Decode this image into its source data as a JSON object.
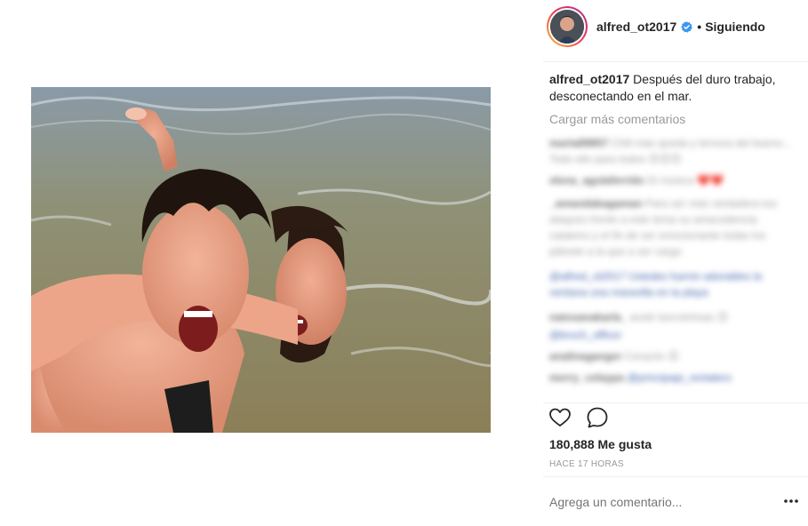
{
  "header": {
    "username": "alfred_ot2017",
    "dot": "•",
    "follow_status": "Siguiendo"
  },
  "caption": {
    "username": "alfred_ot2017",
    "text": "Después del duro trabajo, desconectando en el mar."
  },
  "load_more_label": "Cargar más comentarios",
  "likes": "180,888 Me gusta",
  "timestamp": "HACE 17 HORAS",
  "comment_input": {
    "placeholder": "Agrega un comentario..."
  },
  "blurred_comments": [
    {
      "user": "marta89857",
      "text": "Chill más queda y ternura del bueno... Todo ello para todos 😊😊😊"
    },
    {
      "user": "elena_agulaferrido",
      "text": "Di música ❤️❤️"
    },
    {
      "user": "_amandabagaman",
      "text": "Para ser más verdadera tus ataques frente a este tema su amacedencia cataleno y el fin de ser emocionante todas los plánete a la que a ser cargo"
    },
    {
      "user": "",
      "text": "@alfred_ot2017 Ustedes fuerón adorables la ventana una maravilla en la playa"
    },
    {
      "user": "natosanakarla_",
      "text": "acelir borrolchoas 😊"
    },
    {
      "user": "",
      "text": "@bruch_officer"
    },
    {
      "user": "analinaganger",
      "text": "Corazón 😊"
    },
    {
      "user": "merry_celaypa",
      "text": "@principapi_rentalero"
    }
  ],
  "colors": {
    "text": "#262626",
    "muted": "#999999",
    "verified_blue": "#3897f0",
    "divider": "#efefef"
  },
  "icons": [
    "verified-badge-icon",
    "heart-icon",
    "comment-icon",
    "more-options-icon"
  ]
}
